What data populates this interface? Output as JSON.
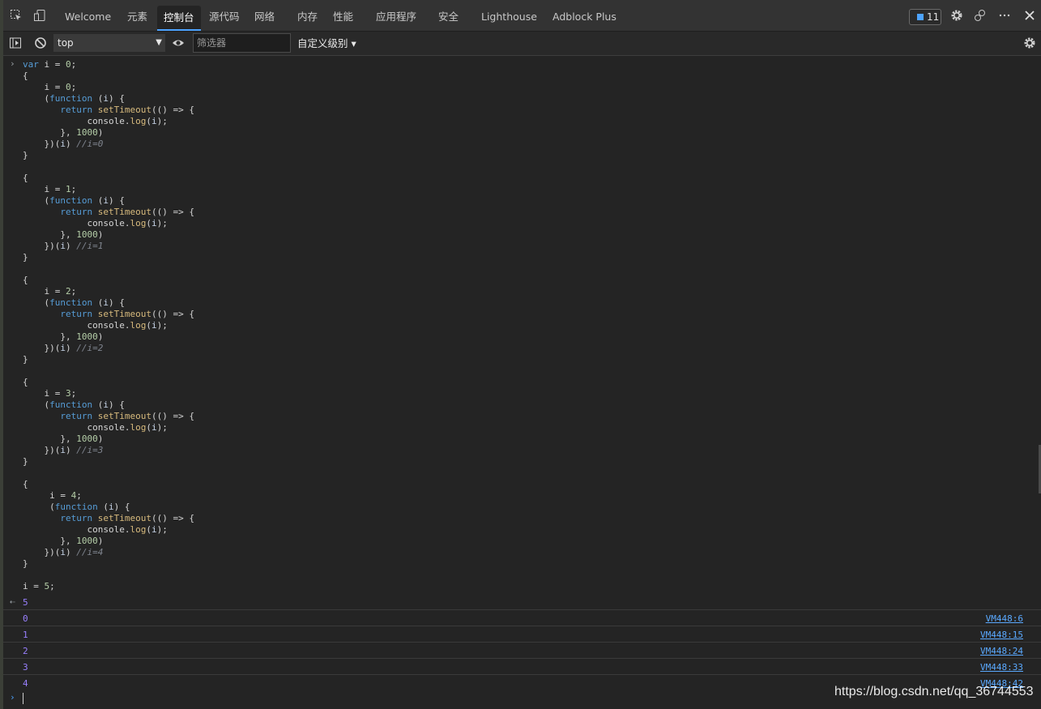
{
  "tabs": [
    {
      "label": "Welcome",
      "active": false
    },
    {
      "label": "元素",
      "active": false
    },
    {
      "label": "控制台",
      "active": true
    },
    {
      "label": "源代码",
      "active": false
    },
    {
      "label": "网络",
      "active": false
    },
    {
      "label": "内存",
      "active": false
    },
    {
      "label": "性能",
      "active": false
    },
    {
      "label": "应用程序",
      "active": false
    },
    {
      "label": "安全",
      "active": false
    },
    {
      "label": "Lighthouse",
      "active": false
    },
    {
      "label": "Adblock Plus",
      "active": false
    }
  ],
  "issues_count": "11",
  "toolbar": {
    "context": "top",
    "filter_placeholder": "筛选器",
    "levels": "自定义级别 ▾"
  },
  "console": {
    "result": "5",
    "logs": [
      {
        "value": "0",
        "source": "VM448:6"
      },
      {
        "value": "1",
        "source": "VM448:15"
      },
      {
        "value": "2",
        "source": "VM448:24"
      },
      {
        "value": "3",
        "source": "VM448:33"
      },
      {
        "value": "4",
        "source": "VM448:42"
      }
    ]
  },
  "watermark": "https://blog.csdn.net/qq_36744553",
  "colors": {
    "accent": "#4da3ff",
    "log_value": "#9980ff",
    "link": "#5aa9ff",
    "background": "#242424"
  },
  "icons": {
    "inspect": "inspect-element-icon",
    "device": "device-toggle-icon",
    "sidebar": "sidebar-toggle-icon",
    "clear": "clear-console-icon",
    "eye": "live-expression-icon",
    "settings": "gear-icon",
    "customize": "customize-icon",
    "more": "more-icon",
    "close": "close-icon"
  }
}
